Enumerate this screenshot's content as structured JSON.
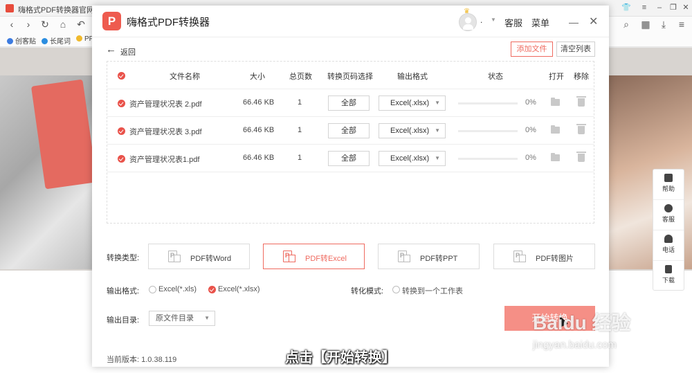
{
  "browser": {
    "tab_title": "嗨格式PDF转换器官网-提供",
    "bookmarks": [
      "创客贴",
      "长尾词",
      "PP"
    ]
  },
  "side_tools": [
    "帮助",
    "客服",
    "电话",
    "下载"
  ],
  "app": {
    "logo_glyph": "P",
    "title": "嗨格式PDF转换器",
    "username": ".",
    "menu_service": "客服",
    "menu_main": "菜单",
    "minimize_glyph": "—",
    "close_glyph": "✕",
    "back_glyph": "←",
    "back_label": "返回",
    "add_files": "添加文件",
    "clear_list": "清空列表"
  },
  "table": {
    "headers": {
      "name": "文件名称",
      "size": "大小",
      "pages": "总页数",
      "page_select": "转换页码选择",
      "format": "输出格式",
      "status": "状态",
      "open": "打开",
      "remove": "移除"
    },
    "rows": [
      {
        "name": "资产管理状况表 2.pdf",
        "size": "66.46 KB",
        "pages": "1",
        "page_select": "全部",
        "format": "Excel(.xlsx)",
        "progress": 0,
        "status": "0%"
      },
      {
        "name": "资产管理状况表 3.pdf",
        "size": "66.46 KB",
        "pages": "1",
        "page_select": "全部",
        "format": "Excel(.xlsx)",
        "progress": 0,
        "status": "0%"
      },
      {
        "name": "资产管理状况表1.pdf",
        "size": "66.46 KB",
        "pages": "1",
        "page_select": "全部",
        "format": "Excel(.xlsx)",
        "progress": 0,
        "status": "0%"
      }
    ]
  },
  "conversion": {
    "type_label": "转换类型:",
    "types": [
      "PDF转Word",
      "PDF转Excel",
      "PDF转PPT",
      "PDF转图片"
    ],
    "active_type": "PDF转Excel",
    "output_format_label": "输出格式:",
    "format_options": [
      "Excel(*.xls)",
      "Excel(*.xlsx)"
    ],
    "selected_format": "Excel(*.xlsx)",
    "mode_label": "转化模式:",
    "mode_option": "转换到一个工作表",
    "output_dir_label": "输出目录:",
    "output_dir_value": "原文件目录",
    "start_button": "开始转换"
  },
  "version": "当前版本: 1.0.38.119",
  "overlay": {
    "caption": "点击【开始转换】",
    "watermark": "Baidu 经验",
    "watermark_url": "jingyan.baidu.com"
  },
  "colors": {
    "accent": "#ef6a5f",
    "start_button": "#f58f86",
    "check": "#e9524a"
  }
}
